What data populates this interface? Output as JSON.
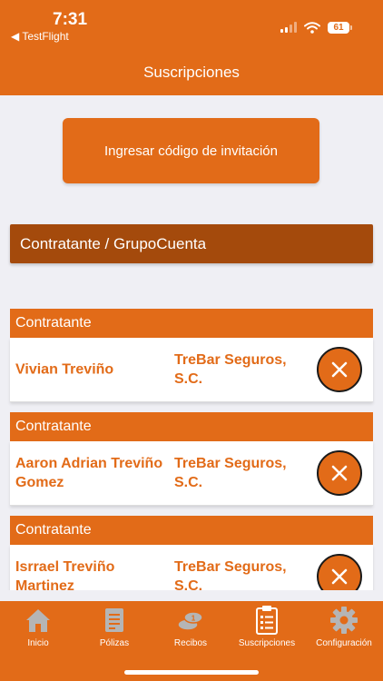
{
  "status_bar": {
    "time": "7:31",
    "back_app": "◀ TestFlight",
    "battery": "61"
  },
  "nav": {
    "title": "Suscripciones"
  },
  "invite_button": {
    "label": "Ingresar código de invitación"
  },
  "group_header": {
    "label": "Contratante / GrupoCuenta"
  },
  "subscriptions": [
    {
      "header": "Contratante",
      "name": "Vivian Treviño",
      "company": "TreBar Seguros, S.C."
    },
    {
      "header": "Contratante",
      "name": "Aaron Adrian Treviño Gomez",
      "company": "TreBar Seguros, S.C."
    },
    {
      "header": "Contratante",
      "name": "Isrrael Treviño Martinez",
      "company": "TreBar Seguros, S.C."
    }
  ],
  "tabs": [
    {
      "label": "Inicio",
      "icon": "home-icon"
    },
    {
      "label": "Pólizas",
      "icon": "policies-icon"
    },
    {
      "label": "Recibos",
      "icon": "coins-icon"
    },
    {
      "label": "Suscripciones",
      "icon": "clipboard-icon"
    },
    {
      "label": "Configuración",
      "icon": "gear-icon"
    }
  ],
  "colors": {
    "accent": "#e26b18",
    "header_dark": "#a44a0c",
    "background": "#efeff4",
    "active_icon": "#ffffff",
    "inactive_icon": "#b5b5b5"
  }
}
